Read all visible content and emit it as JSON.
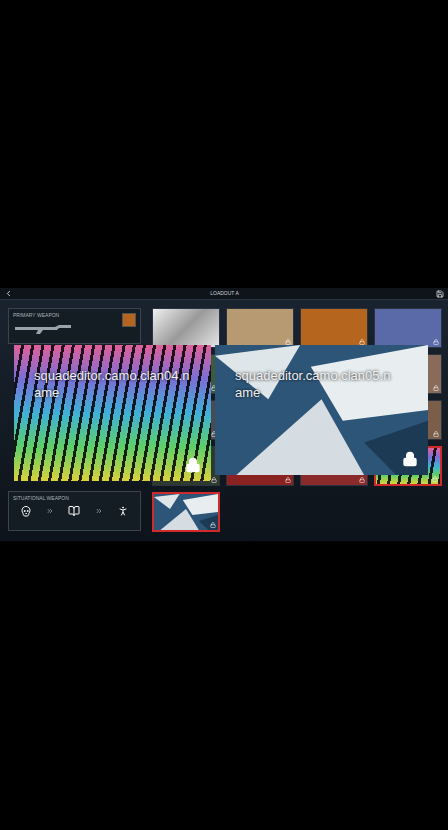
{
  "header": {
    "title": "LOADOUT A"
  },
  "primary_panel": {
    "label": "PRIMARY WEAPON"
  },
  "perk_panel": {
    "label": "SITUATIONAL WEAPON"
  },
  "camos": [
    {
      "kind": "snow",
      "color": "#d8d8d8",
      "locked": false,
      "selected": false
    },
    {
      "kind": "plain",
      "color": "#b89a72",
      "locked": true,
      "selected": false
    },
    {
      "kind": "plain",
      "color": "#b5651d",
      "locked": true,
      "selected": false
    },
    {
      "kind": "plain",
      "color": "#5a6aa8",
      "locked": true,
      "selected": false
    },
    {
      "kind": "plain",
      "color": "#3d5a3a",
      "locked": true,
      "selected": false
    },
    {
      "kind": "plain",
      "color": "#6b5b45",
      "locked": true,
      "selected": false
    },
    {
      "kind": "plain",
      "color": "#2f3b2f",
      "locked": true,
      "selected": false
    },
    {
      "kind": "plain",
      "color": "#8a6b5a",
      "locked": true,
      "selected": false
    },
    {
      "kind": "plain",
      "color": "#4a4a52",
      "locked": true,
      "selected": false
    },
    {
      "kind": "plain",
      "color": "#5b6d4a",
      "locked": true,
      "selected": false
    },
    {
      "kind": "plain",
      "color": "#3a3a3a",
      "locked": true,
      "selected": false
    },
    {
      "kind": "plain",
      "color": "#7a5e4a",
      "locked": true,
      "selected": false
    },
    {
      "kind": "plain",
      "color": "#2e3a2e",
      "locked": true,
      "selected": false
    },
    {
      "kind": "plain",
      "color": "#8a2222",
      "locked": true,
      "selected": false
    },
    {
      "kind": "plain",
      "color": "#8a2a2a",
      "locked": true,
      "selected": false
    },
    {
      "kind": "zebra",
      "color": "#3fb0d8",
      "locked": true,
      "selected": true
    },
    {
      "kind": "shards",
      "color": "#2d5578",
      "locked": true,
      "selected": true
    }
  ],
  "tooltips": [
    {
      "name": "squadeditor.camo.clan04.name",
      "kind": "zebra",
      "color": "#3fb0d8",
      "locked": true
    },
    {
      "name": "squadeditor.camo.clan05.name",
      "kind": "shards",
      "color": "#2d5578",
      "locked": true
    }
  ]
}
